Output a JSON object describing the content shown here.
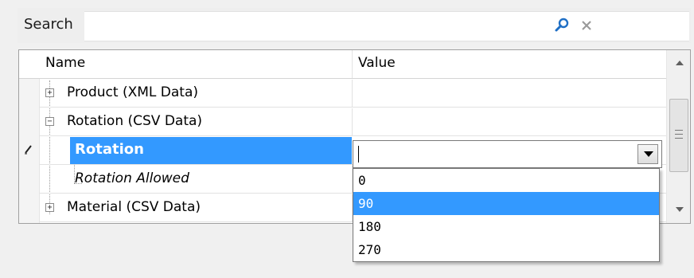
{
  "search": {
    "label": "Search",
    "value": "",
    "search_icon": "magnifier-icon",
    "clear_icon": "close-icon"
  },
  "grid": {
    "columns": {
      "name": "Name",
      "value": "Value"
    },
    "rows": [
      {
        "label": "Product (XML Data)",
        "type": "category",
        "expanded": false
      },
      {
        "label": "Rotation (CSV Data)",
        "type": "category",
        "expanded": true
      },
      {
        "label": "Rotation",
        "type": "property",
        "selected": true,
        "editing": true,
        "value": ""
      },
      {
        "label": "Rotation Allowed",
        "type": "property",
        "italic": true
      },
      {
        "label": "Material (CSV Data)",
        "type": "category",
        "expanded": false
      }
    ],
    "tree_symbols": {
      "expand": "+",
      "collapse": "−"
    }
  },
  "dropdown": {
    "options": [
      "0",
      "90",
      "180",
      "270"
    ],
    "highlighted": "90"
  },
  "colors": {
    "selection": "#3399ff",
    "background": "#f0f0f0"
  }
}
